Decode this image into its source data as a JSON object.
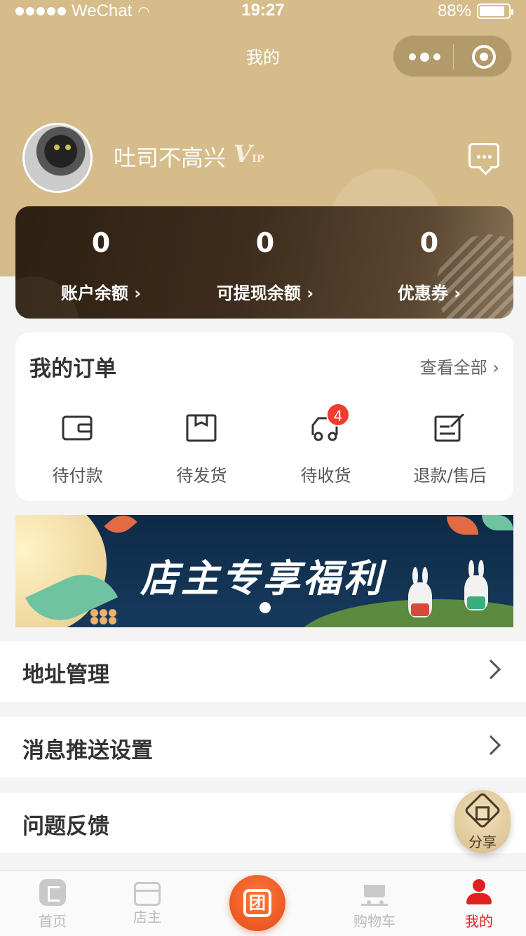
{
  "status_bar": {
    "carrier": "WeChat",
    "time": "19:27",
    "battery": "88%",
    "battery_level": 0.88
  },
  "nav": {
    "title": "我的"
  },
  "profile": {
    "username": "吐司不高兴",
    "vip_badge": "V",
    "vip_badge_small": "IP"
  },
  "balances": [
    {
      "value": "0",
      "label": "账户余额 ›"
    },
    {
      "value": "0",
      "label": "可提现余额 ›"
    },
    {
      "value": "0",
      "label": "优惠券 ›"
    }
  ],
  "orders": {
    "title": "我的订单",
    "view_all": "查看全部 ›",
    "items": [
      {
        "label": "待付款",
        "icon": "wallet-icon"
      },
      {
        "label": "待发货",
        "icon": "box-icon"
      },
      {
        "label": "待收货",
        "icon": "truck-icon",
        "badge": "4"
      },
      {
        "label": "退款/售后",
        "icon": "edit-icon"
      }
    ]
  },
  "banner": {
    "text": "店主专享福利"
  },
  "menu": [
    {
      "label": "地址管理"
    },
    {
      "label": "消息推送设置"
    },
    {
      "label": "问题反馈"
    }
  ],
  "share": {
    "label": "分享"
  },
  "tabbar": [
    {
      "label": "首页",
      "icon": "home-icon"
    },
    {
      "label": "店主",
      "icon": "store-icon"
    },
    {
      "label": "",
      "icon": "group-buy-icon",
      "center_glyph": "团"
    },
    {
      "label": "购物车",
      "icon": "cart-icon"
    },
    {
      "label": "我的",
      "icon": "profile-icon",
      "active": true
    }
  ],
  "colors": {
    "header": "#d6bc8a",
    "accent_red": "#e02020",
    "badge_red": "#f23c2e",
    "card_dark": "#2d2012"
  }
}
